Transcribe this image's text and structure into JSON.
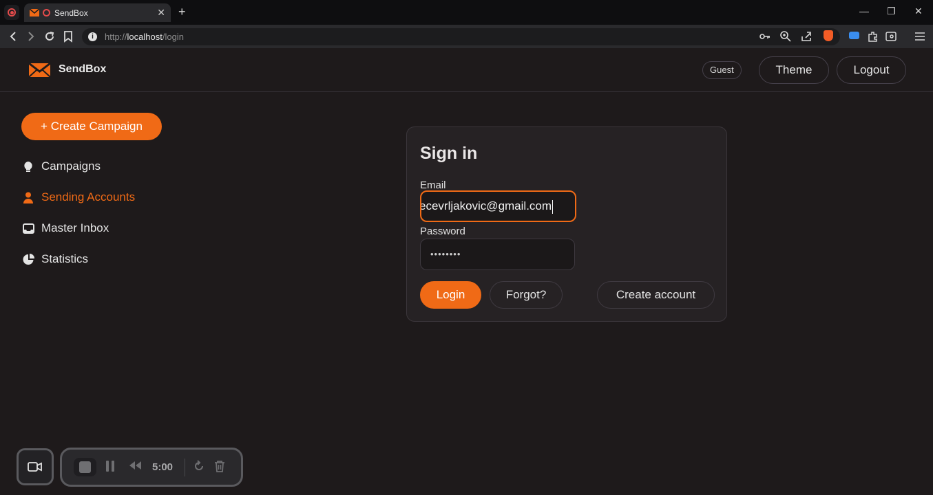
{
  "browser": {
    "tab_title": "SendBox",
    "tab_close": "✕",
    "new_tab": "+",
    "url_prefix": "http://",
    "url_host": "localhost",
    "url_path": "/login",
    "window_controls": [
      "—",
      "❐",
      "✕"
    ]
  },
  "header": {
    "brand": "SendBox",
    "user_badge": "Guest",
    "theme_label": "Theme",
    "logout_label": "Logout"
  },
  "sidebar": {
    "create_label": "+ Create Campaign",
    "items": [
      {
        "label": "Campaigns",
        "icon": "lightbulb-icon",
        "active": false
      },
      {
        "label": "Sending Accounts",
        "icon": "user-icon",
        "active": true
      },
      {
        "label": "Master Inbox",
        "icon": "inbox-icon",
        "active": false
      },
      {
        "label": "Statistics",
        "icon": "pie-chart-icon",
        "active": false
      }
    ]
  },
  "signin": {
    "title": "Sign in",
    "email_label": "Email",
    "email_value": "ecevrljakovic@gmail.com",
    "password_label": "Password",
    "password_value": "••••••••",
    "login_label": "Login",
    "forgot_label": "Forgot?",
    "create_account_label": "Create account"
  },
  "recorder": {
    "time": "5:00"
  },
  "colors": {
    "accent": "#f06a16",
    "background": "#1e1a1b",
    "card": "#262224"
  }
}
